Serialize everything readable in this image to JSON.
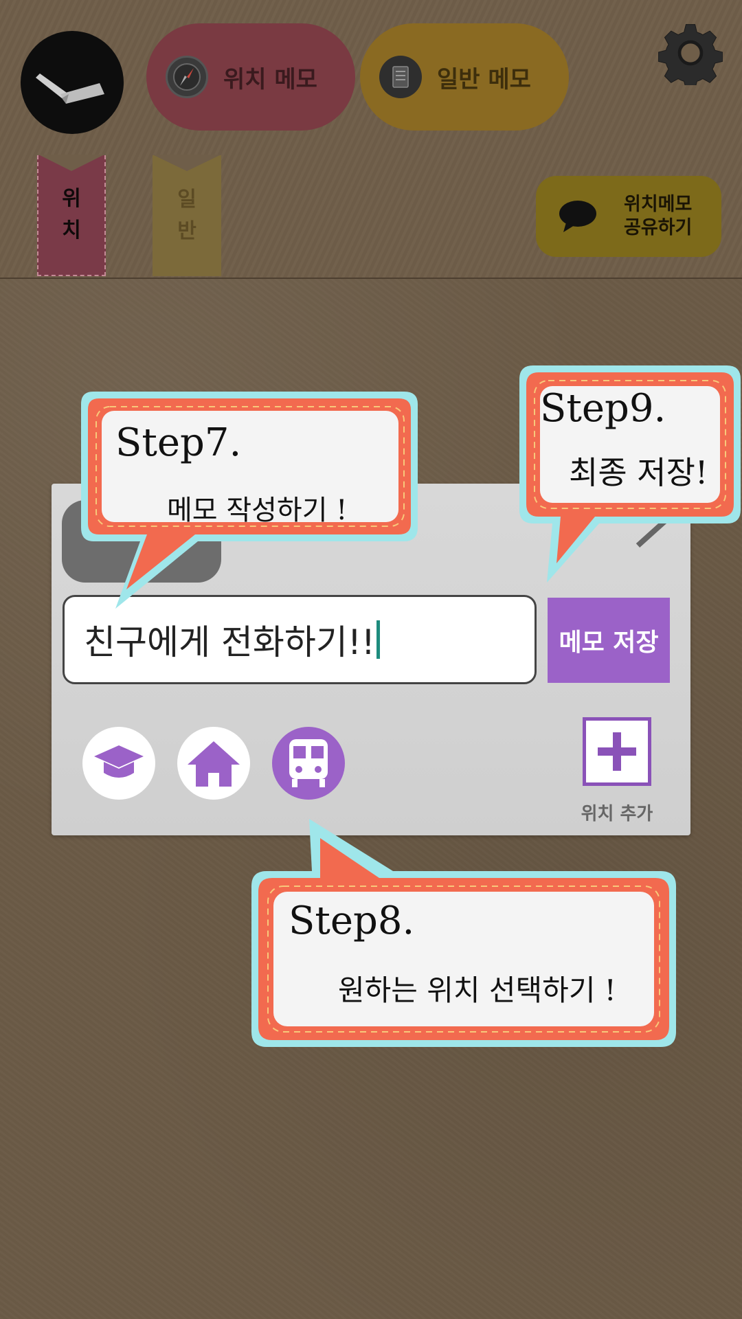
{
  "header": {
    "location_memo_label": "위치 메모",
    "general_memo_label": "일반 메모",
    "tab_location_chars": [
      "위",
      "치"
    ],
    "tab_general_chars": [
      "일",
      "반"
    ],
    "share_label_line1": "위치메모",
    "share_label_line2": "공유하기"
  },
  "memo_card": {
    "input_value": "친구에게  전화하기!!",
    "save_label": "메모 저장",
    "add_place_label": "위치 추가",
    "place_icons": [
      "graduation-cap-icon",
      "home-icon",
      "train-icon"
    ]
  },
  "callouts": {
    "step7_title": "Step7.",
    "step7_text": "메모 작성하기 !",
    "step8_title": "Step8.",
    "step8_text": "원하는 위치 선택하기 !",
    "step9_title": "Step9.",
    "step9_text": "최종 저장!"
  },
  "colors": {
    "accent_purple": "#9b62c8",
    "callout_border": "#f26a4f",
    "callout_outline": "#9fe6ea",
    "background": "#6b5a46"
  }
}
